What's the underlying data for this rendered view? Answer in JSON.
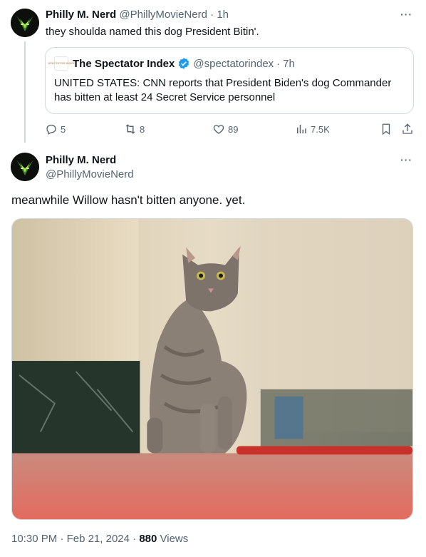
{
  "tweet1": {
    "author_name": "Philly M. Nerd",
    "author_handle": "@PhillyMovieNerd",
    "separator": "·",
    "time": "1h",
    "text": "they shoulda named this dog President Bitin'.",
    "more_icon": "more-dots-icon",
    "quote": {
      "logo_text": "SPECTATOR INDEX",
      "author_name": "The Spectator Index",
      "author_handle": "@spectatorindex",
      "separator": "·",
      "time": "7h",
      "verified_color": "#1d9bf0",
      "text": "UNITED STATES: CNN reports that President Biden's dog Commander has bitten at least 24 Secret Service personnel"
    },
    "actions": {
      "replies": "5",
      "retweets": "8",
      "likes": "89",
      "views": "7.5K",
      "icons": [
        "reply-icon",
        "retweet-icon",
        "like-icon",
        "views-icon",
        "bookmark-icon",
        "share-icon"
      ]
    }
  },
  "tweet2": {
    "author_name": "Philly M. Nerd",
    "author_handle": "@PhillyMovieNerd",
    "more_icon": "more-dots-icon",
    "text": "meanwhile Willow hasn't bitten anyone. yet.",
    "photo_subject": "cat-photo",
    "meta": {
      "time": "10:30 PM",
      "separator": "·",
      "date": "Feb 21, 2024",
      "separator2": "·",
      "views_count": "880",
      "views_label": "Views"
    }
  },
  "colors": {
    "text": "#0f1419",
    "muted": "#536471",
    "border": "#cfd9de",
    "accent": "#1d9bf0"
  }
}
